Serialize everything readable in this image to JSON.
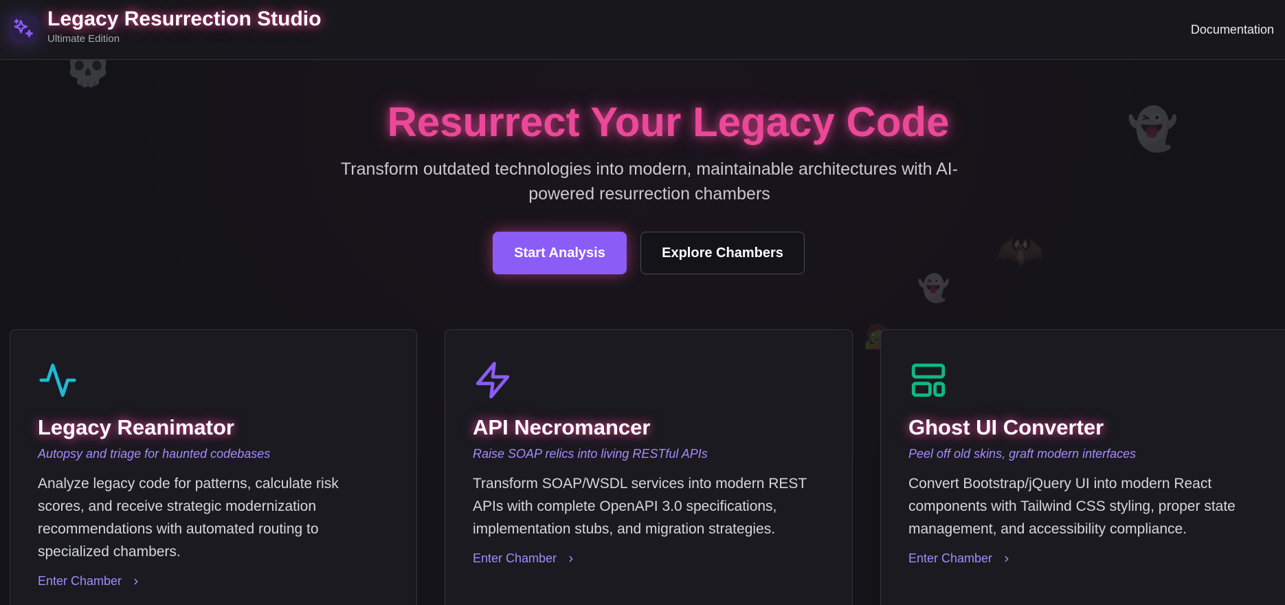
{
  "header": {
    "title": "Legacy Resurrection Studio",
    "subtitle": "Ultimate Edition",
    "nav_documentation": "Documentation"
  },
  "hero": {
    "title": "Resurrect Your Legacy Code",
    "subtitle": "Transform outdated technologies into modern, maintainable architectures with AI-powered resurrection chambers",
    "primary_button": "Start Analysis",
    "secondary_button": "Explore Chambers"
  },
  "cards": [
    {
      "icon": "activity-icon",
      "icon_color": "#22b8d6",
      "title": "Legacy Reanimator",
      "tagline": "Autopsy and triage for haunted codebases",
      "description": "Analyze legacy code for patterns, calculate risk scores, and receive strategic modernization recommendations with automated routing to specialized chambers.",
      "link": "Enter Chamber"
    },
    {
      "icon": "lightning-icon",
      "icon_color": "#8b5cf6",
      "title": "API Necromancer",
      "tagline": "Raise SOAP relics into living RESTful APIs",
      "description": "Transform SOAP/WSDL services into modern REST APIs with complete OpenAPI 3.0 specifications, implementation stubs, and migration strategies.",
      "link": "Enter Chamber"
    },
    {
      "icon": "layout-icon",
      "icon_color": "#10b981",
      "title": "Ghost UI Converter",
      "tagline": "Peel off old skins, graft modern interfaces",
      "description": "Convert Bootstrap/jQuery UI into modern React components with Tailwind CSS styling, proper state management, and accessibility compliance.",
      "link": "Enter Chamber"
    }
  ],
  "colors": {
    "accent_pink": "#ec4899",
    "accent_purple": "#8b5cf6",
    "link_purple": "#a78bfa",
    "background": "#141418"
  }
}
